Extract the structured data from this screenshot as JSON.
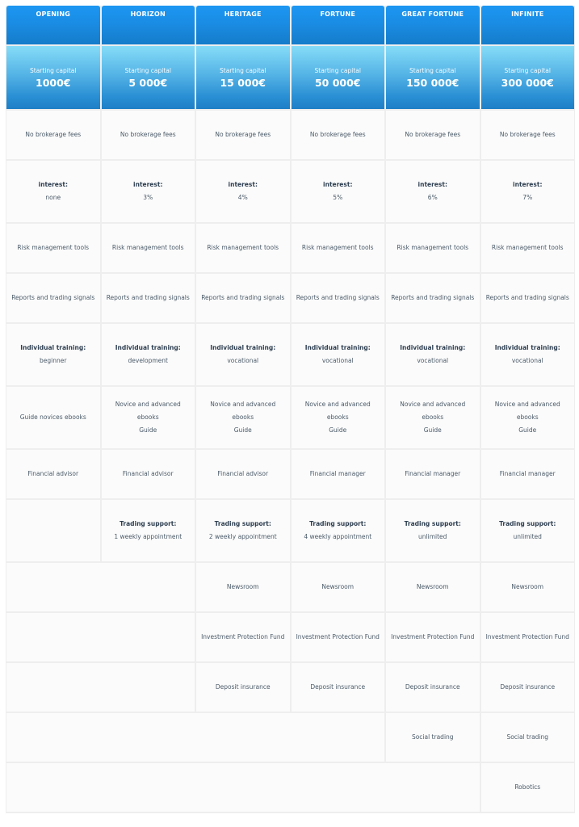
{
  "plans": [
    {
      "name": "OPENING",
      "capital_label": "Starting capital",
      "capital": "1000€"
    },
    {
      "name": "HORIZON",
      "capital_label": "Starting capital",
      "capital": "5 000€"
    },
    {
      "name": "HERITAGE",
      "capital_label": "Starting capital",
      "capital": "15 000€"
    },
    {
      "name": "FORTUNE",
      "capital_label": "Starting capital",
      "capital": "50 000€"
    },
    {
      "name": "GREAT FORTUNE",
      "capital_label": "Starting capital",
      "capital": "150 000€"
    },
    {
      "name": "INFINITE",
      "capital_label": "Starting capital",
      "capital": "300 000€"
    }
  ],
  "features": {
    "brokerage": [
      "No brokerage fees",
      "No brokerage fees",
      "No brokerage fees",
      "No brokerage fees",
      "No brokerage fees",
      "No brokerage fees"
    ],
    "interest_label": "interest:",
    "interest": [
      "none",
      "3%",
      "4%",
      "5%",
      "6%",
      "7%"
    ],
    "risk": [
      "Risk management tools",
      "Risk management tools",
      "Risk management tools",
      "Risk management tools",
      "Risk management tools",
      "Risk management tools"
    ],
    "reports": [
      "Reports and trading signals",
      "Reports and trading signals",
      "Reports and trading signals",
      "Reports and trading signals",
      "Reports and trading signals",
      "Reports and trading signals"
    ],
    "training_label": "Individual training:",
    "training": [
      "beginner",
      "development",
      "vocational",
      "vocational",
      "vocational",
      "vocational"
    ],
    "ebooks": [
      {
        "line1": "Guide novices ebooks",
        "line2": ""
      },
      {
        "line1": "Novice and advanced ebooks",
        "line2": "Guide"
      },
      {
        "line1": "Novice and advanced ebooks",
        "line2": "Guide"
      },
      {
        "line1": "Novice and advanced ebooks",
        "line2": "Guide"
      },
      {
        "line1": "Novice and advanced ebooks",
        "line2": "Guide"
      },
      {
        "line1": "Novice and advanced ebooks",
        "line2": "Guide"
      }
    ],
    "advisor": [
      "Financial advisor",
      "Financial advisor",
      "Financial advisor",
      "Financial manager",
      "Financial manager",
      "Financial manager"
    ],
    "support_label": "Trading support:",
    "support": [
      "1 weekly appointment",
      "2 weekly appointment",
      "4 weekly appointment",
      "unlimited",
      "unlimited"
    ],
    "newsroom": [
      "Newsroom",
      "Newsroom",
      "Newsroom",
      "Newsroom"
    ],
    "protection_fund": [
      "Investment Protection Fund",
      "Investment Protection Fund",
      "Investment Protection Fund",
      "Investment Protection Fund"
    ],
    "deposit": [
      "Deposit insurance",
      "Deposit insurance",
      "Deposit insurance",
      "Deposit insurance"
    ],
    "social": [
      "Social trading",
      "Social trading"
    ],
    "robotics": [
      "Robotics"
    ]
  }
}
